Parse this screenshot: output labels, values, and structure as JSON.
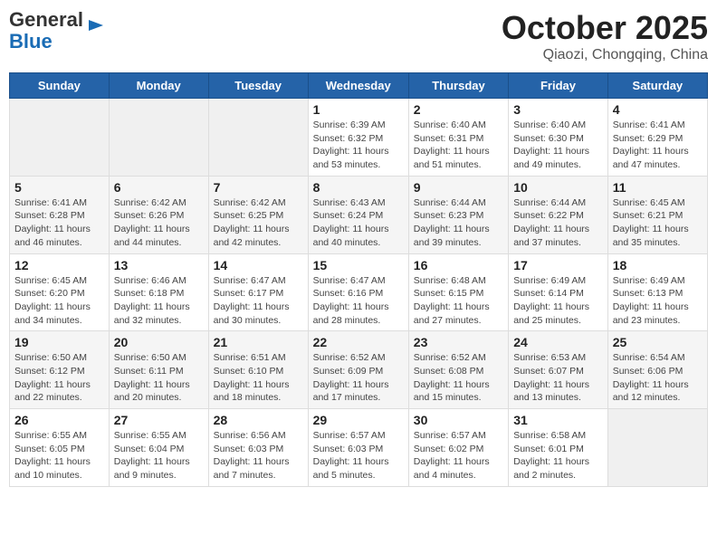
{
  "header": {
    "logo_line1": "General",
    "logo_line2": "Blue",
    "title": "October 2025",
    "subtitle": "Qiaozi, Chongqing, China"
  },
  "days_of_week": [
    "Sunday",
    "Monday",
    "Tuesday",
    "Wednesday",
    "Thursday",
    "Friday",
    "Saturday"
  ],
  "weeks": [
    [
      {
        "day": "",
        "info": ""
      },
      {
        "day": "",
        "info": ""
      },
      {
        "day": "",
        "info": ""
      },
      {
        "day": "1",
        "info": "Sunrise: 6:39 AM\nSunset: 6:32 PM\nDaylight: 11 hours and 53 minutes."
      },
      {
        "day": "2",
        "info": "Sunrise: 6:40 AM\nSunset: 6:31 PM\nDaylight: 11 hours and 51 minutes."
      },
      {
        "day": "3",
        "info": "Sunrise: 6:40 AM\nSunset: 6:30 PM\nDaylight: 11 hours and 49 minutes."
      },
      {
        "day": "4",
        "info": "Sunrise: 6:41 AM\nSunset: 6:29 PM\nDaylight: 11 hours and 47 minutes."
      }
    ],
    [
      {
        "day": "5",
        "info": "Sunrise: 6:41 AM\nSunset: 6:28 PM\nDaylight: 11 hours and 46 minutes."
      },
      {
        "day": "6",
        "info": "Sunrise: 6:42 AM\nSunset: 6:26 PM\nDaylight: 11 hours and 44 minutes."
      },
      {
        "day": "7",
        "info": "Sunrise: 6:42 AM\nSunset: 6:25 PM\nDaylight: 11 hours and 42 minutes."
      },
      {
        "day": "8",
        "info": "Sunrise: 6:43 AM\nSunset: 6:24 PM\nDaylight: 11 hours and 40 minutes."
      },
      {
        "day": "9",
        "info": "Sunrise: 6:44 AM\nSunset: 6:23 PM\nDaylight: 11 hours and 39 minutes."
      },
      {
        "day": "10",
        "info": "Sunrise: 6:44 AM\nSunset: 6:22 PM\nDaylight: 11 hours and 37 minutes."
      },
      {
        "day": "11",
        "info": "Sunrise: 6:45 AM\nSunset: 6:21 PM\nDaylight: 11 hours and 35 minutes."
      }
    ],
    [
      {
        "day": "12",
        "info": "Sunrise: 6:45 AM\nSunset: 6:20 PM\nDaylight: 11 hours and 34 minutes."
      },
      {
        "day": "13",
        "info": "Sunrise: 6:46 AM\nSunset: 6:18 PM\nDaylight: 11 hours and 32 minutes."
      },
      {
        "day": "14",
        "info": "Sunrise: 6:47 AM\nSunset: 6:17 PM\nDaylight: 11 hours and 30 minutes."
      },
      {
        "day": "15",
        "info": "Sunrise: 6:47 AM\nSunset: 6:16 PM\nDaylight: 11 hours and 28 minutes."
      },
      {
        "day": "16",
        "info": "Sunrise: 6:48 AM\nSunset: 6:15 PM\nDaylight: 11 hours and 27 minutes."
      },
      {
        "day": "17",
        "info": "Sunrise: 6:49 AM\nSunset: 6:14 PM\nDaylight: 11 hours and 25 minutes."
      },
      {
        "day": "18",
        "info": "Sunrise: 6:49 AM\nSunset: 6:13 PM\nDaylight: 11 hours and 23 minutes."
      }
    ],
    [
      {
        "day": "19",
        "info": "Sunrise: 6:50 AM\nSunset: 6:12 PM\nDaylight: 11 hours and 22 minutes."
      },
      {
        "day": "20",
        "info": "Sunrise: 6:50 AM\nSunset: 6:11 PM\nDaylight: 11 hours and 20 minutes."
      },
      {
        "day": "21",
        "info": "Sunrise: 6:51 AM\nSunset: 6:10 PM\nDaylight: 11 hours and 18 minutes."
      },
      {
        "day": "22",
        "info": "Sunrise: 6:52 AM\nSunset: 6:09 PM\nDaylight: 11 hours and 17 minutes."
      },
      {
        "day": "23",
        "info": "Sunrise: 6:52 AM\nSunset: 6:08 PM\nDaylight: 11 hours and 15 minutes."
      },
      {
        "day": "24",
        "info": "Sunrise: 6:53 AM\nSunset: 6:07 PM\nDaylight: 11 hours and 13 minutes."
      },
      {
        "day": "25",
        "info": "Sunrise: 6:54 AM\nSunset: 6:06 PM\nDaylight: 11 hours and 12 minutes."
      }
    ],
    [
      {
        "day": "26",
        "info": "Sunrise: 6:55 AM\nSunset: 6:05 PM\nDaylight: 11 hours and 10 minutes."
      },
      {
        "day": "27",
        "info": "Sunrise: 6:55 AM\nSunset: 6:04 PM\nDaylight: 11 hours and 9 minutes."
      },
      {
        "day": "28",
        "info": "Sunrise: 6:56 AM\nSunset: 6:03 PM\nDaylight: 11 hours and 7 minutes."
      },
      {
        "day": "29",
        "info": "Sunrise: 6:57 AM\nSunset: 6:03 PM\nDaylight: 11 hours and 5 minutes."
      },
      {
        "day": "30",
        "info": "Sunrise: 6:57 AM\nSunset: 6:02 PM\nDaylight: 11 hours and 4 minutes."
      },
      {
        "day": "31",
        "info": "Sunrise: 6:58 AM\nSunset: 6:01 PM\nDaylight: 11 hours and 2 minutes."
      },
      {
        "day": "",
        "info": ""
      }
    ]
  ]
}
